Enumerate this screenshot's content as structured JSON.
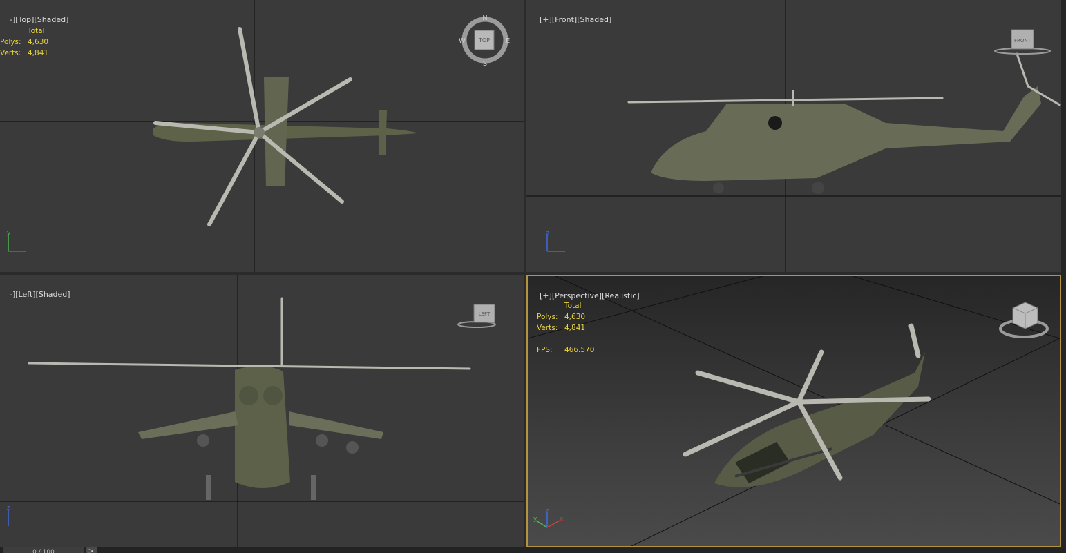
{
  "viewports": {
    "top": {
      "label_bracket": "-]",
      "view": "[Top]",
      "mode": "[Shaded]"
    },
    "front": {
      "plus": "[+]",
      "view": "[Front]",
      "mode": "[Shaded]"
    },
    "left": {
      "label_bracket": "-]",
      "view": "[Left]",
      "mode": "[Shaded]"
    },
    "perspective": {
      "plus": "[+]",
      "view": "[Perspective]",
      "mode": "[Realistic]"
    }
  },
  "stats_top": {
    "header": "Total",
    "polys_label": "Polys:",
    "polys": "4,630",
    "verts_label": "Verts:",
    "verts": "4,841"
  },
  "stats_persp": {
    "header": "Total",
    "polys_label": "Polys:",
    "polys": "4,630",
    "verts_label": "Verts:",
    "verts": "4,841",
    "fps_label": "FPS:",
    "fps": "466.570"
  },
  "viewcube": {
    "top_face": "TOP",
    "front_face": "FRONT",
    "left_face": "LEFT",
    "compass_n": "N",
    "compass_s": "S",
    "compass_e": "E",
    "compass_w": "W"
  },
  "axes": {
    "x": "x",
    "y": "y",
    "z": "z"
  },
  "timeslider": {
    "frame": "0 / 100",
    "next": ">"
  },
  "colors": {
    "stats": "#e7d23c",
    "active_border": "#b39340",
    "viewport_bg": "#3a3a3a"
  }
}
